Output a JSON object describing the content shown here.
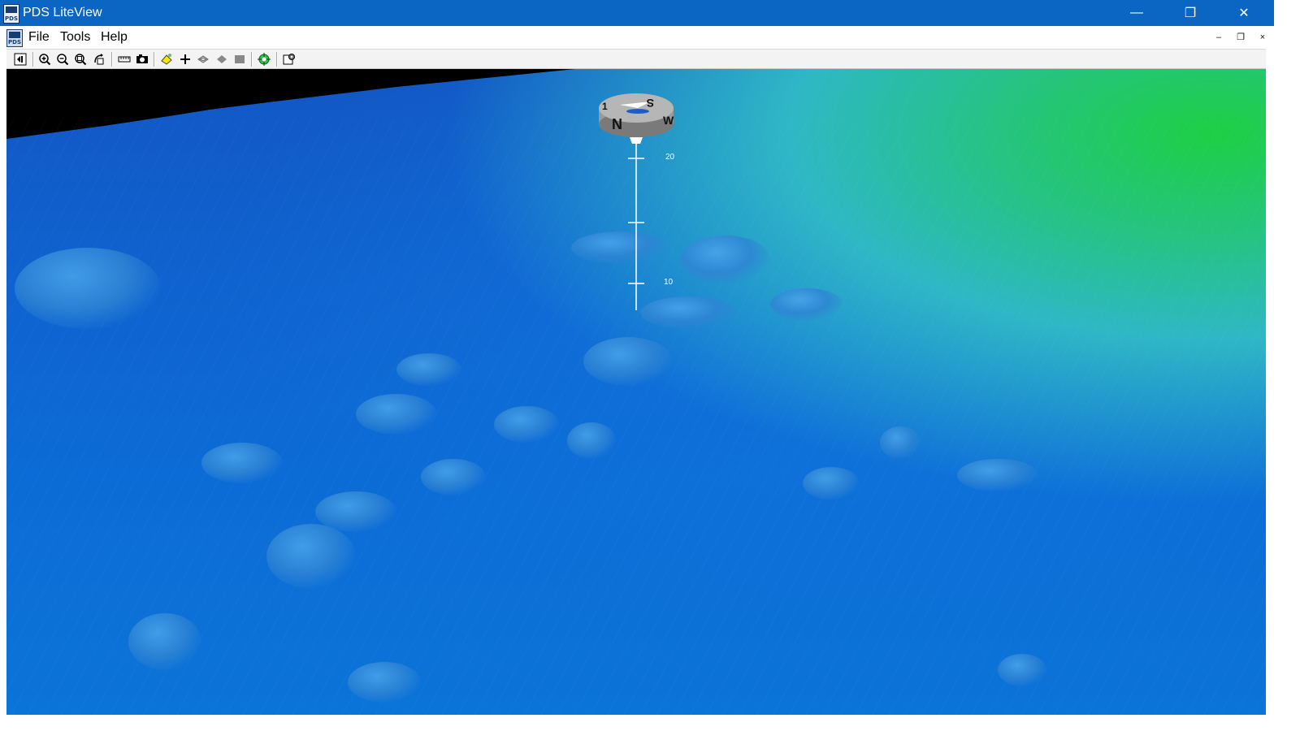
{
  "window": {
    "title": "PDS LiteView",
    "app_icon_text": "PDS"
  },
  "window_controls": {
    "minimize": "—",
    "maximize": "❐",
    "close": "✕"
  },
  "menu": {
    "items": [
      "File",
      "Tools",
      "Help"
    ]
  },
  "mdi_controls": {
    "minimize": "–",
    "restore": "❐",
    "close": "×"
  },
  "toolbar": {
    "icons": [
      "fit-view-icon",
      "zoom-in-icon",
      "zoom-out-icon",
      "zoom-window-icon",
      "rotate-icon",
      "ruler-icon",
      "camera-icon",
      "highlight-icon",
      "crosshair-icon",
      "surface-icon",
      "solid-icon",
      "fill-icon",
      "target-icon",
      "settings-icon"
    ]
  },
  "scene": {
    "compass": {
      "labels": [
        "N",
        "W",
        "S",
        "1"
      ]
    },
    "depth_scale": {
      "labels": [
        "20",
        "10"
      ]
    },
    "colors": {
      "deep": "#0f63d0",
      "mid": "#2fb7c6",
      "shallow": "#1ecf44",
      "sky": "#000000"
    }
  }
}
